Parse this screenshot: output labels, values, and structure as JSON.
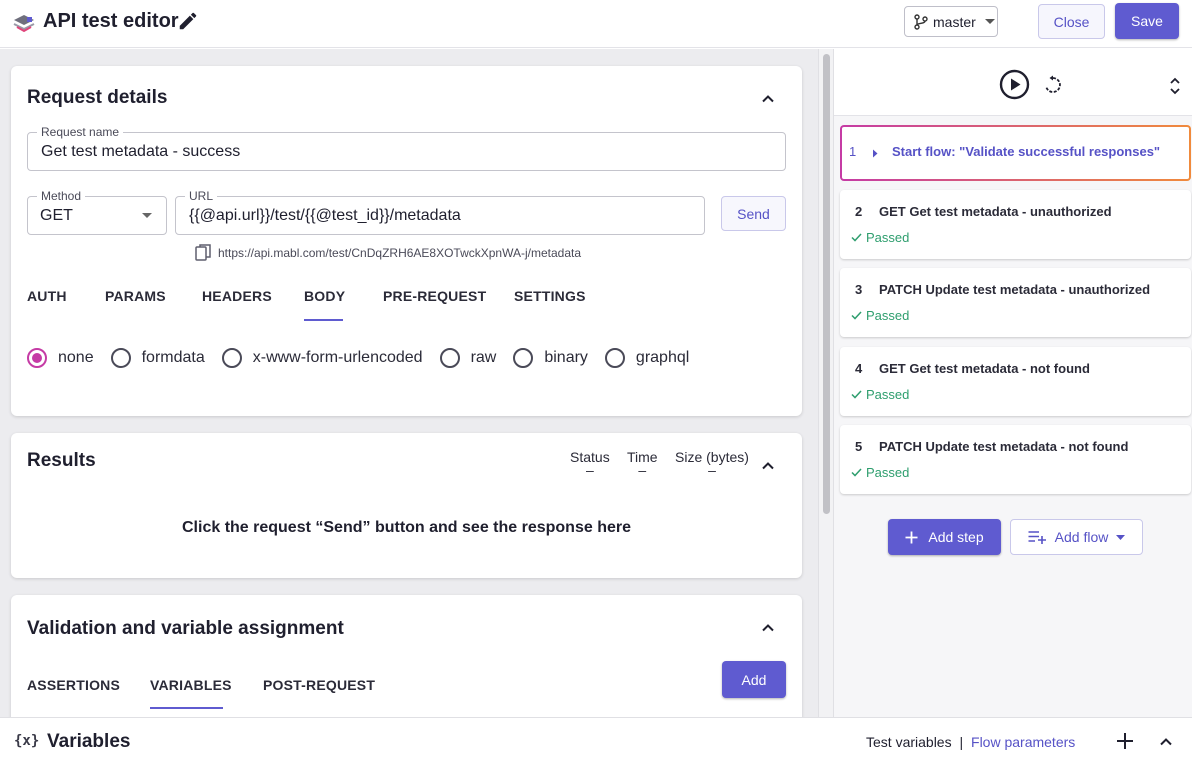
{
  "header": {
    "title": "API test editor",
    "branch": "master",
    "close_label": "Close",
    "save_label": "Save"
  },
  "request": {
    "section_title": "Request details",
    "name_label": "Request name",
    "name_value": "Get test metadata - success",
    "method_label": "Method",
    "method_value": "GET",
    "url_label": "URL",
    "url_value": "{{@api.url}}/test/{{@test_id}}/metadata",
    "send_label": "Send",
    "resolved_url": "https://api.mabl.com/test/CnDqZRH6AE8XOTwckXpnWA-j/metadata",
    "tabs": [
      "AUTH",
      "PARAMS",
      "HEADERS",
      "BODY",
      "PRE-REQUEST",
      "SETTINGS"
    ],
    "active_tab": "BODY",
    "body_options": [
      "none",
      "formdata",
      "x-www-form-urlencoded",
      "raw",
      "binary",
      "graphql"
    ],
    "selected_body_option": "none"
  },
  "results": {
    "section_title": "Results",
    "columns": [
      {
        "label": "Status",
        "value": "–"
      },
      {
        "label": "Time",
        "value": "–"
      },
      {
        "label": "Size (bytes)",
        "value": "–"
      }
    ],
    "empty_message": "Click the request “Send” button and see the response here"
  },
  "validation": {
    "section_title": "Validation and variable assignment",
    "tabs": [
      "ASSERTIONS",
      "VARIABLES",
      "POST-REQUEST"
    ],
    "active_tab": "VARIABLES",
    "add_label": "Add"
  },
  "flow": {
    "steps": [
      {
        "num": "1",
        "title": "Start flow: \"Validate successful responses\"",
        "status": ""
      },
      {
        "num": "2",
        "title": "GET Get test metadata - unauthorized",
        "status": "Passed"
      },
      {
        "num": "3",
        "title": "PATCH Update test metadata - unauthorized",
        "status": "Passed"
      },
      {
        "num": "4",
        "title": "GET Get test metadata - not found",
        "status": "Passed"
      },
      {
        "num": "5",
        "title": "PATCH Update test metadata - not found",
        "status": "Passed"
      }
    ],
    "add_step_label": "Add step",
    "add_flow_label": "Add flow"
  },
  "bottom": {
    "icon_text": "{x}",
    "title": "Variables",
    "test_variables": "Test variables",
    "separator": "|",
    "flow_parameters": "Flow parameters"
  },
  "colors": {
    "primary": "#5f5bd0",
    "accent_radio": "#c53ba5",
    "passed": "#2e9e6e",
    "flow_border_start": "#c53ba5",
    "flow_border_end": "#f08a3c"
  },
  "icons": {
    "logo": "mabl-logo-icon",
    "edit": "pencil-icon",
    "branch": "git-branch-icon",
    "play": "play-circle-icon",
    "rerun": "replay-icon",
    "expand": "expand-collapse-icon",
    "copy": "copy-icon",
    "check": "check-icon",
    "plus": "plus-icon",
    "chevron": "chevron-up-icon"
  }
}
